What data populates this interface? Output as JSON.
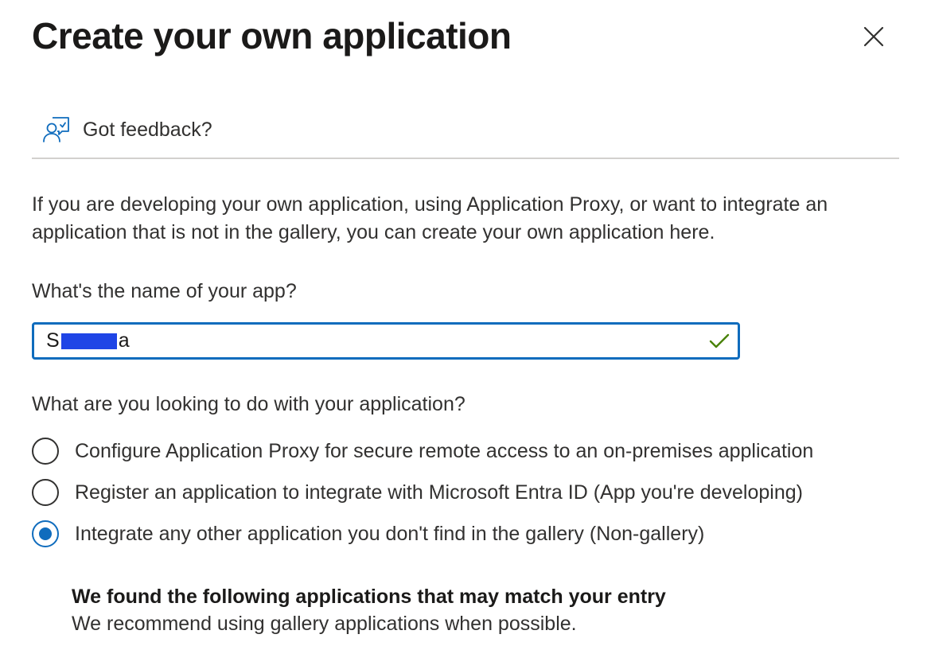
{
  "panel": {
    "title": "Create your own application",
    "close_icon": "close-icon"
  },
  "feedback": {
    "icon": "feedback-icon",
    "label": "Got feedback?"
  },
  "intro": {
    "text": "If you are developing your own application, using Application Proxy, or want to integrate an application that is not in the gallery, you can create your own application here."
  },
  "app_name": {
    "label": "What's the name of your app?",
    "value_prefix": "S",
    "value_suffix": "a",
    "redacted": true,
    "status_icon": "checkmark-icon"
  },
  "purpose": {
    "question": "What are you looking to do with your application?",
    "options": [
      {
        "label": "Configure Application Proxy for secure remote access to an on-premises application",
        "selected": false
      },
      {
        "label": "Register an application to integrate with Microsoft Entra ID (App you're developing)",
        "selected": false
      },
      {
        "label": "Integrate any other application you don't find in the gallery (Non-gallery)",
        "selected": true
      }
    ]
  },
  "matches": {
    "heading": "We found the following applications that may match your entry",
    "subtext": "We recommend using gallery applications when possible."
  },
  "colors": {
    "accent": "#0f6cbd",
    "success": "#498205",
    "redaction": "#1f45e6",
    "text": "#323130",
    "divider": "#d2d0ce"
  }
}
